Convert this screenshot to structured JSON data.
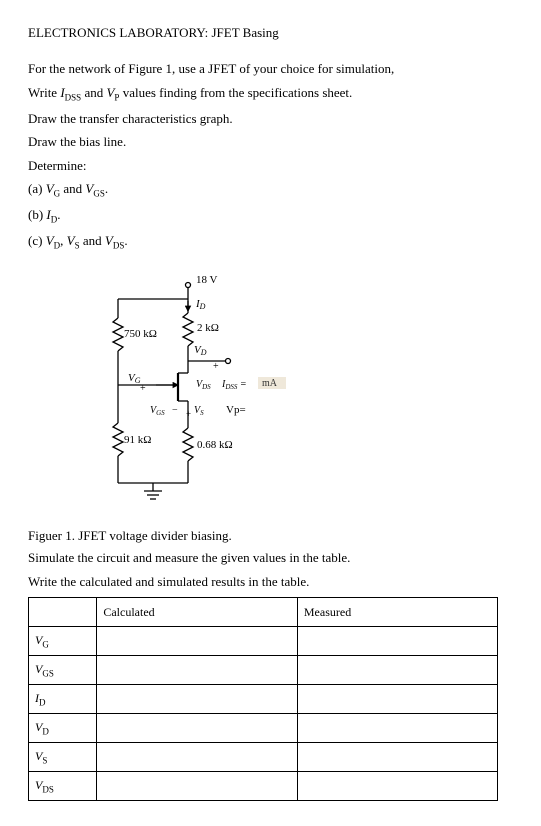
{
  "title": "ELECTRONICS LABORATORY: JFET Basing",
  "intro": [
    "For the network of Figure 1, use a JFET of your choice for simulation,",
    "Write I_DSS and V_P values finding from the specifications sheet.",
    "Draw the transfer characteristics graph.",
    "Draw the bias line.",
    "Determine:",
    "(a) V_G and V_GS.",
    "(b) I_D.",
    "(c) V_D, V_S and V_DS."
  ],
  "circuit": {
    "vsupply": "18 V",
    "r_top": "750 kΩ",
    "r_bottom": "91 kΩ",
    "r_drain": "2 kΩ",
    "r_source": "0.68 kΩ",
    "id_label": "I_D",
    "vd_label": "V_D",
    "vg_label": "V_G",
    "vgs_label": "V_GS",
    "vs_label": "V_S",
    "vds_label": "V_DS",
    "idss_label": "I_DSS =",
    "idss_unit": "mA",
    "vp_label": "Vp="
  },
  "caption": "Figuer 1. JFET voltage divider biasing.",
  "instr1": "Simulate the circuit and measure the given values in the table.",
  "instr2": "Write the calculated and simulated results in the table.",
  "table": {
    "header_calc": "Calculated",
    "header_meas": "Measured",
    "rows": [
      "V_G",
      "V_GS",
      "I_D",
      "V_D",
      "V_S",
      "V_DS"
    ]
  }
}
